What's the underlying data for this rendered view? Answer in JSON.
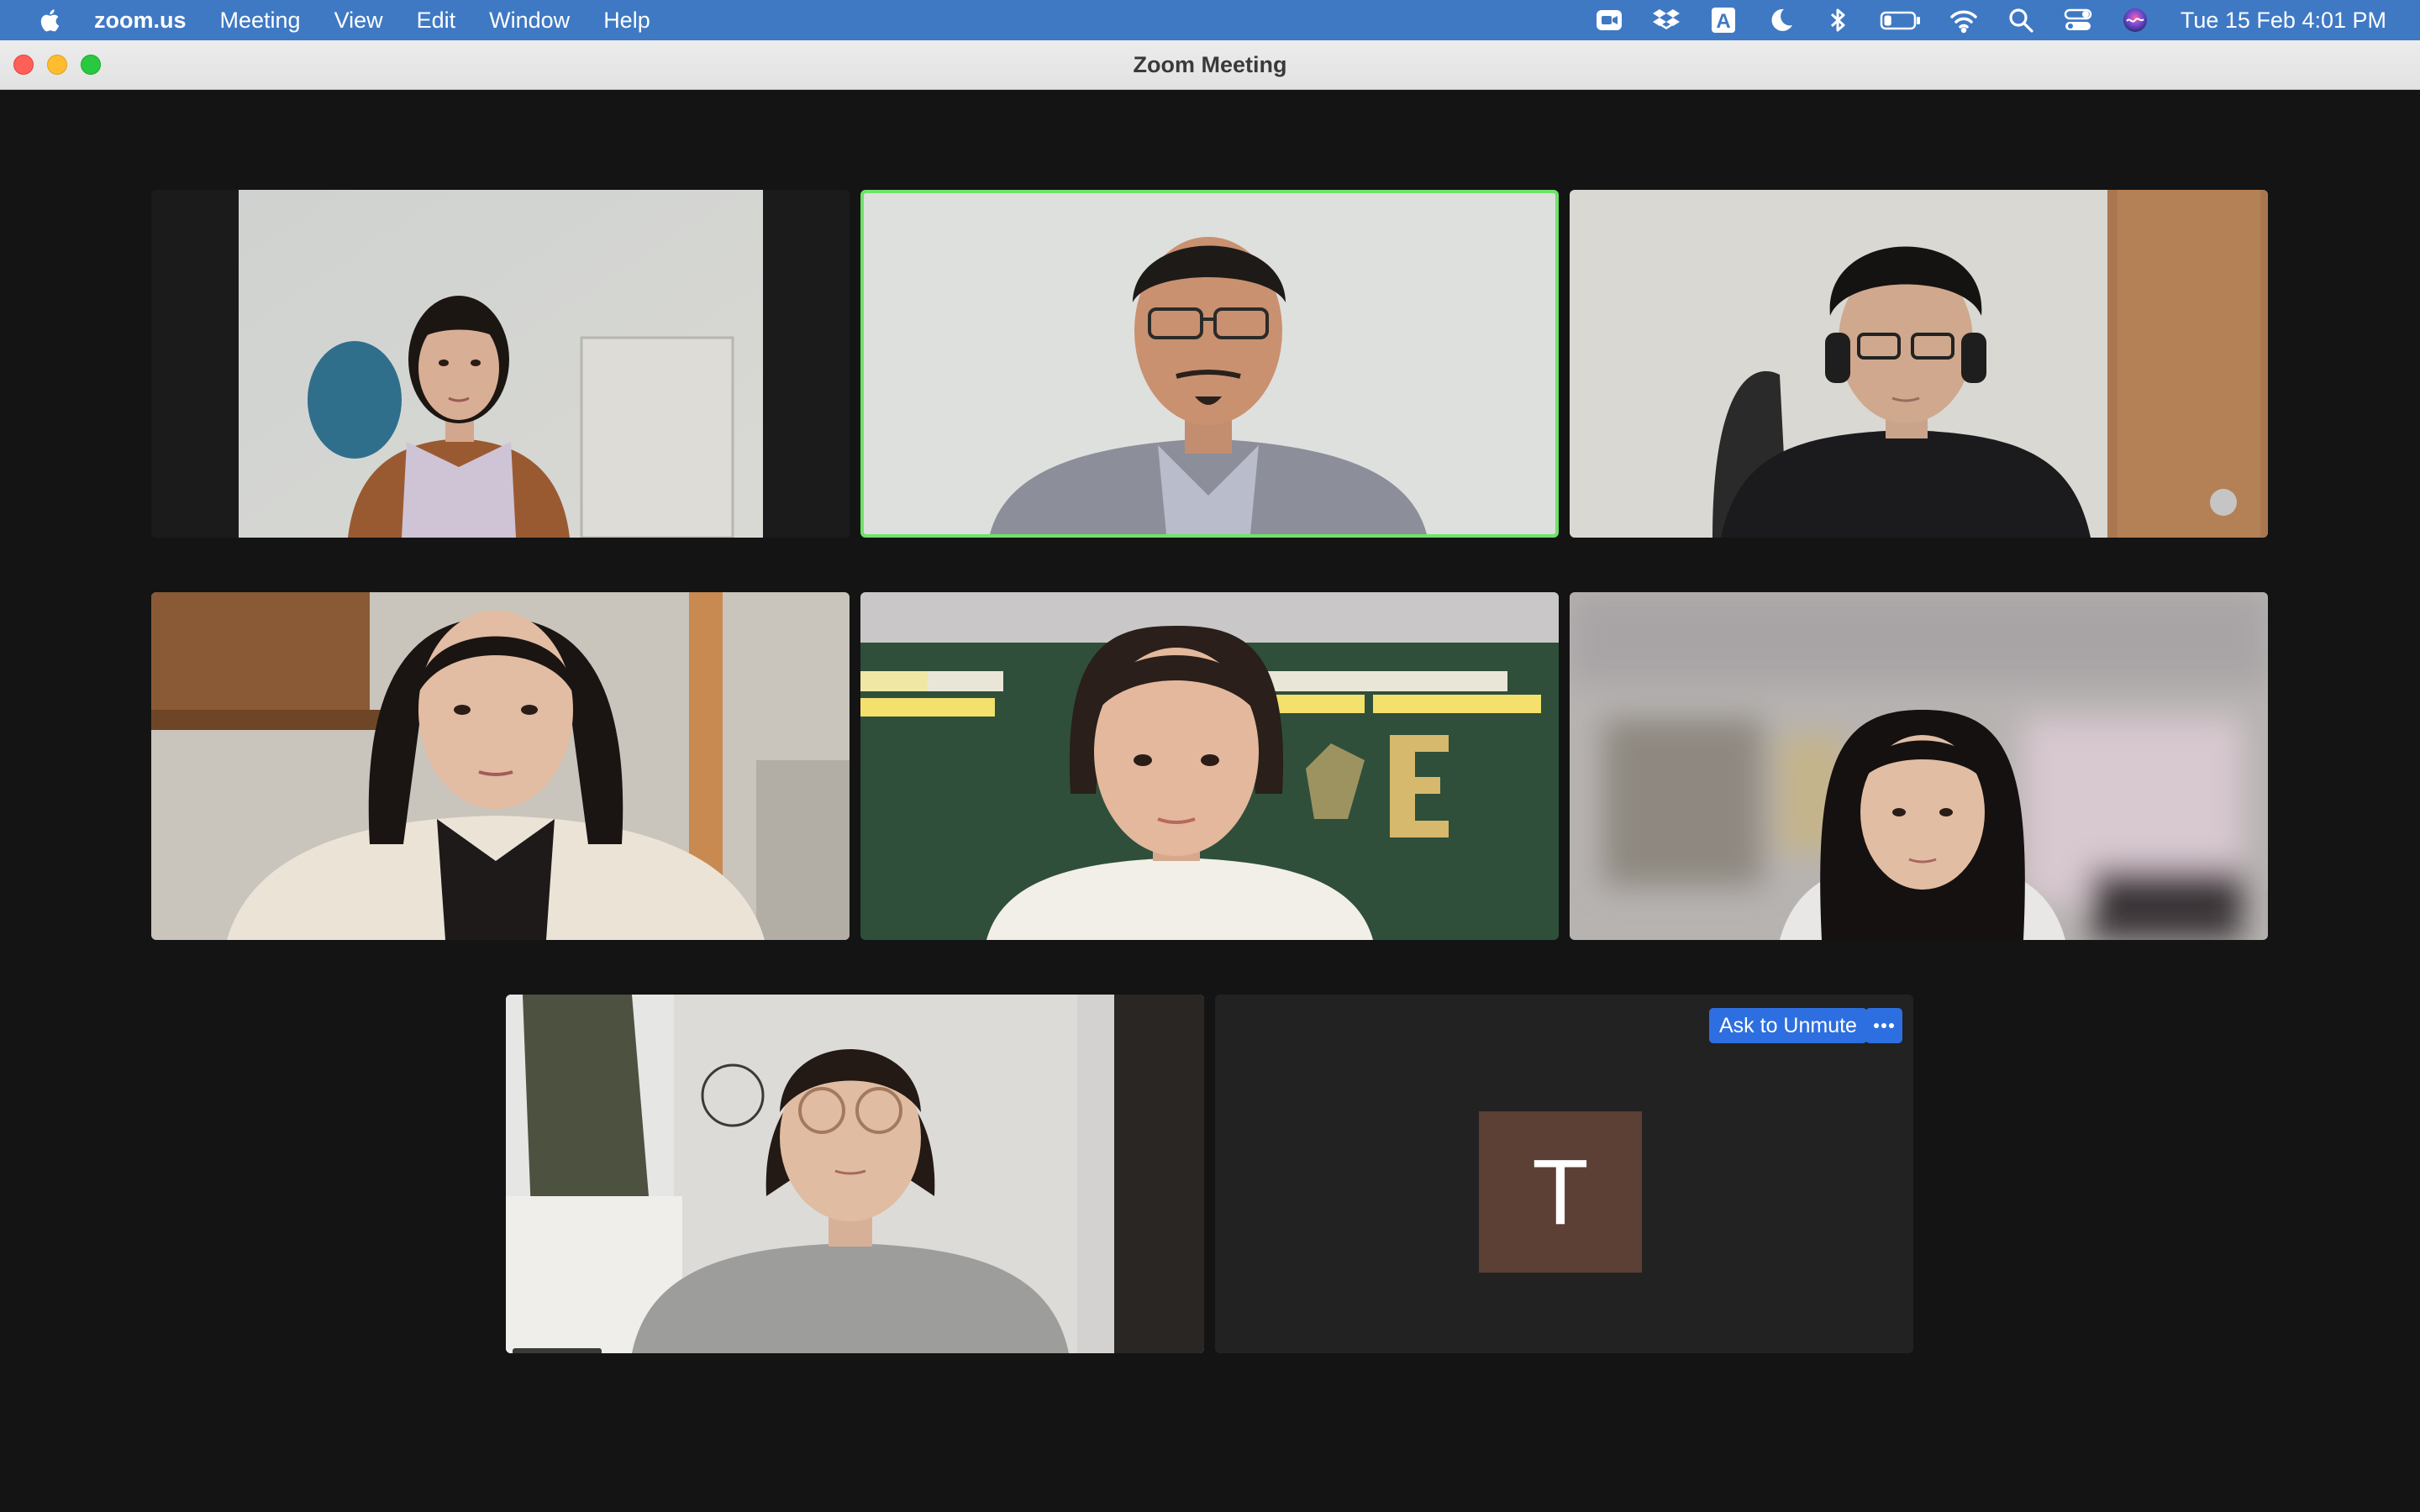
{
  "menubar": {
    "app": "zoom.us",
    "items": [
      {
        "label": "Meeting"
      },
      {
        "label": "View"
      },
      {
        "label": "Edit"
      },
      {
        "label": "Window"
      },
      {
        "label": "Help"
      }
    ],
    "status_icons": [
      "zoom-video-icon",
      "dropbox-icon",
      "input-source-icon",
      "focus-moon-icon",
      "bluetooth-icon",
      "battery-icon",
      "wifi-icon",
      "spotlight-search-icon",
      "control-center-icon",
      "siri-icon"
    ],
    "input_source_letter": "A",
    "battery_level": 0.25,
    "clock": "Tue 15 Feb  4:01 PM"
  },
  "window": {
    "title": "Zoom Meeting"
  },
  "participants": [
    {
      "tile": 1,
      "kind": "video",
      "active_speaker": false
    },
    {
      "tile": 2,
      "kind": "video",
      "active_speaker": true
    },
    {
      "tile": 3,
      "kind": "video",
      "active_speaker": false
    },
    {
      "tile": 4,
      "kind": "video",
      "active_speaker": false
    },
    {
      "tile": 5,
      "kind": "video",
      "active_speaker": false
    },
    {
      "tile": 6,
      "kind": "video",
      "active_speaker": false
    },
    {
      "tile": 7,
      "kind": "video",
      "active_speaker": false
    },
    {
      "tile": 8,
      "kind": "avatar",
      "avatar_letter": "T",
      "avatar_color": "#5c3f35"
    }
  ],
  "tile_controls": {
    "ask_to_unmute": "Ask to Unmute",
    "more_icon": "ellipsis-icon"
  },
  "colors": {
    "menubar": "#3f79c4",
    "gallery_background": "#141414",
    "active_speaker_border": "#6fe26a",
    "button_blue": "#2d6fe0"
  }
}
